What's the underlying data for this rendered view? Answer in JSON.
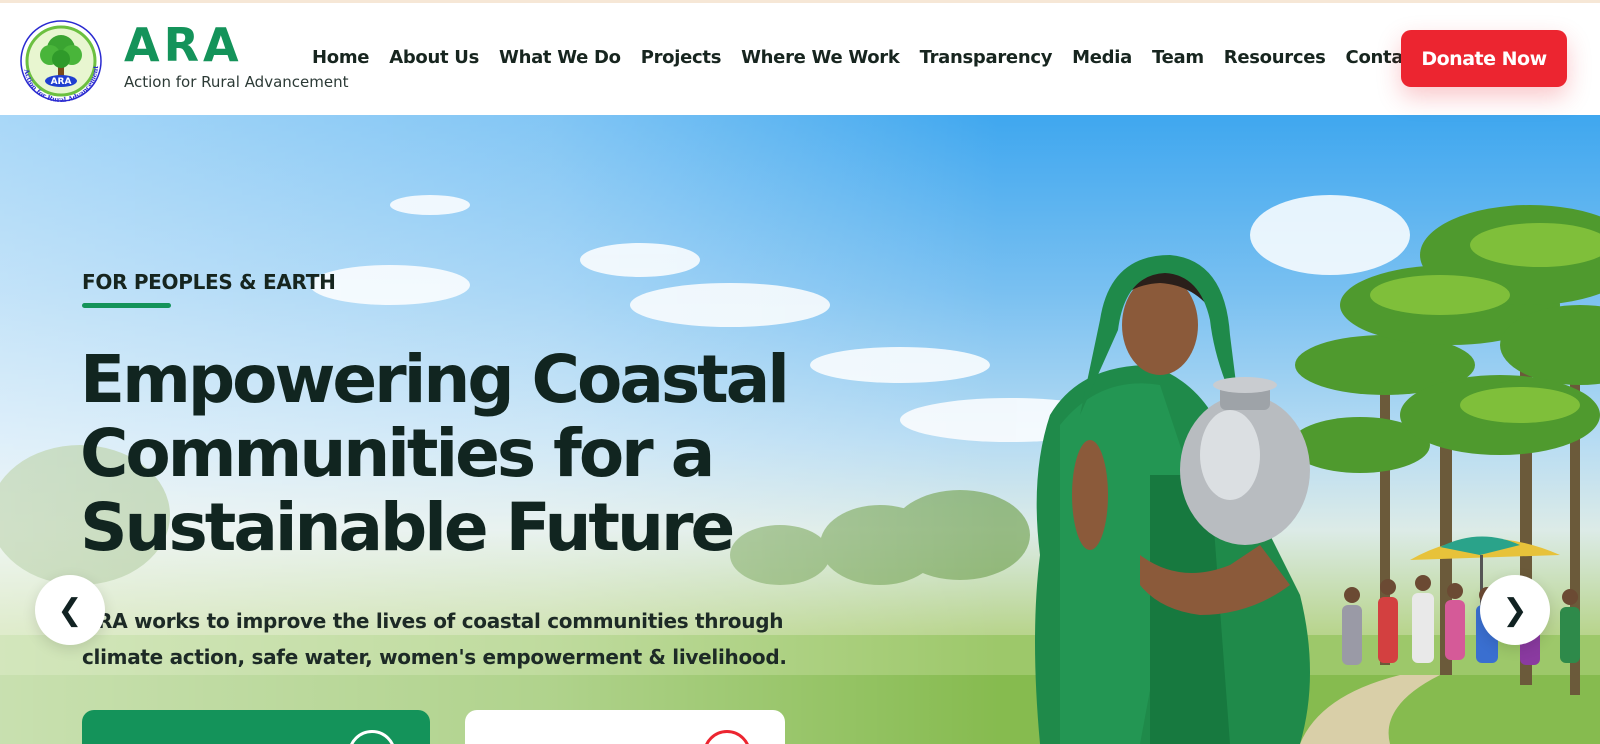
{
  "brand": {
    "name": "ARA",
    "tagline": "Action for Rural Advancement",
    "logo_text": "ARA",
    "logo_ring_text": "Action for Rural Advancement"
  },
  "nav": {
    "items": [
      {
        "label": "Home"
      },
      {
        "label": "About Us"
      },
      {
        "label": "What We Do"
      },
      {
        "label": "Projects"
      },
      {
        "label": "Where We Work"
      },
      {
        "label": "Transparency"
      },
      {
        "label": "Media"
      },
      {
        "label": "Team"
      },
      {
        "label": "Resources"
      },
      {
        "label": "Contact"
      }
    ],
    "donate_label": "Donate Now"
  },
  "hero": {
    "eyebrow": "FOR PEOPLES & EARTH",
    "headline": "Empowering Coastal Communities for a Sustainable Future",
    "lead": "ARA works to improve the lives of coastal communities through climate action, safe water, women's empowerment & livelihood.",
    "prev_icon": "❮",
    "next_icon": "❯"
  },
  "colors": {
    "brand_green": "#14935a",
    "donate_red": "#ec2530",
    "heading": "#112520"
  },
  "icons": [
    "tree-logo-icon",
    "chevron-left-icon",
    "chevron-right-icon"
  ]
}
